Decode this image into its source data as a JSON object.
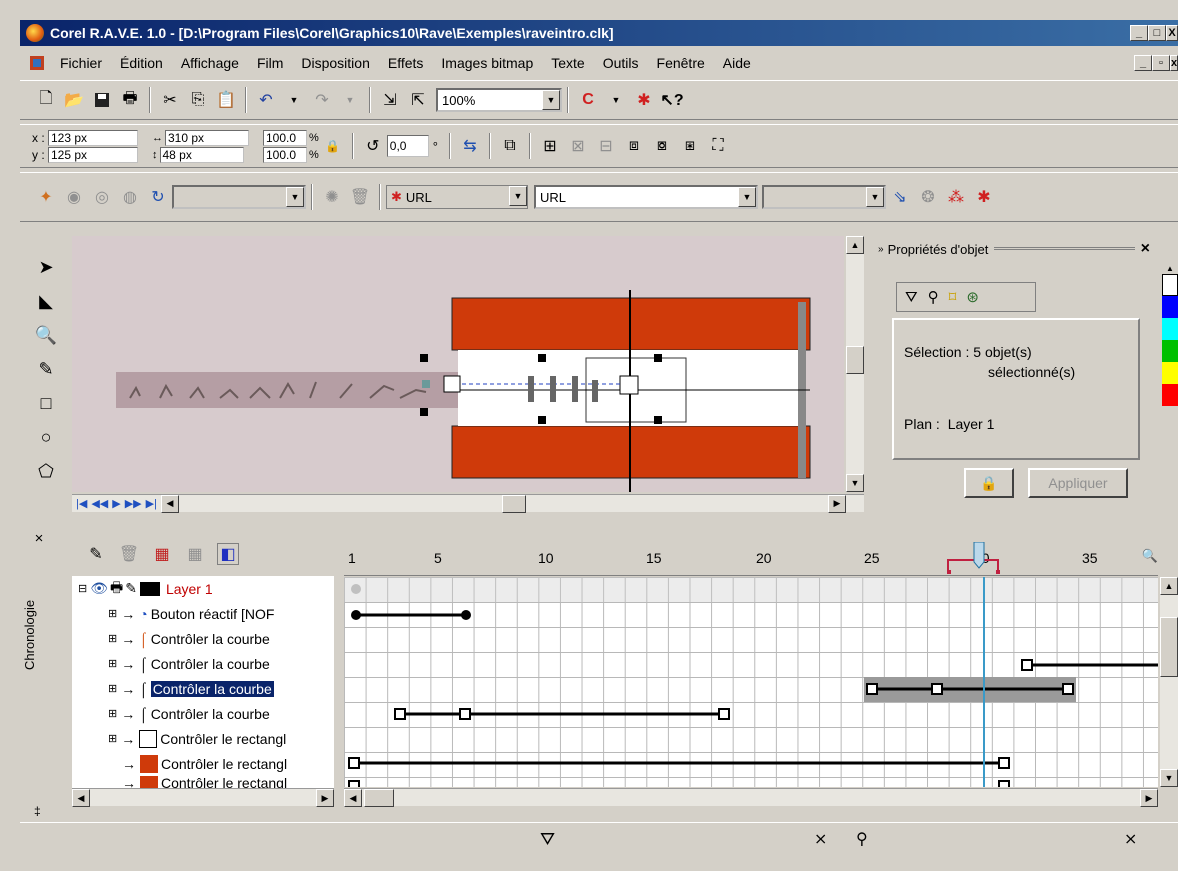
{
  "window": {
    "title": "Corel R.A.V.E. 1.0 - [D:\\Program Files\\Corel\\Graphics10\\Rave\\Exemples\\raveintro.clk]",
    "min": "_",
    "max": "□",
    "close": "X"
  },
  "menu": [
    "Fichier",
    "Édition",
    "Affichage",
    "Film",
    "Disposition",
    "Effets",
    "Images bitmap",
    "Texte",
    "Outils",
    "Fenêtre",
    "Aide"
  ],
  "toolbar": {
    "zoom": "100%"
  },
  "propbar": {
    "x_label": "x :",
    "x_value": "123 px",
    "y_label": "y :",
    "y_value": "125 px",
    "w_value": "310 px",
    "h_value": "48 px",
    "scale_x": "100.0",
    "scale_y": "100.0",
    "pct": "%",
    "rotation": "0,0",
    "deg": "°"
  },
  "urlbar": {
    "url_label": "URL",
    "url_value": "URL"
  },
  "docker": {
    "title": "Propriétés d'objet",
    "close": "×",
    "selection_label": "Sélection :",
    "selection_value": "5 objet(s)",
    "selection_value2": "sélectionné(s)",
    "plan_label": "Plan :",
    "plan_value": "Layer 1",
    "apply_label": "Appliquer"
  },
  "timeline": {
    "side_label": "Chronologie",
    "side_close": "×",
    "ruler_ticks": [
      "1",
      "5",
      "10",
      "15",
      "20",
      "25",
      "30",
      "35"
    ],
    "current_frame": 30,
    "layer_name": "Layer 1",
    "rows": [
      {
        "label": "Bouton réactif  [NOF",
        "icon": "rollover-button-icon"
      },
      {
        "label": "Contrôler la courbe",
        "icon": "curve-orange-icon"
      },
      {
        "label": "Contrôler la courbe",
        "icon": "curve-black-icon"
      },
      {
        "label": "Contrôler la courbe",
        "icon": "curve-black-icon",
        "selected": true
      },
      {
        "label": "Contrôler la courbe",
        "icon": "curve-black-icon"
      },
      {
        "label": "Contrôler le rectangl",
        "icon": "rectangle-white-icon"
      },
      {
        "label": "Contrôler le rectangl",
        "icon": "rectangle-red-icon"
      },
      {
        "label": "Contrôler le rectangl",
        "icon": "rectangle-red-icon"
      }
    ]
  },
  "status": {
    "fill_icon": "fill-bucket-icon",
    "outline_icon": "pen-nib-icon"
  },
  "palette": [
    "#ffffff",
    "#0000ff",
    "#00ffff",
    "#00c000",
    "#ffff00",
    "#ff0000"
  ]
}
